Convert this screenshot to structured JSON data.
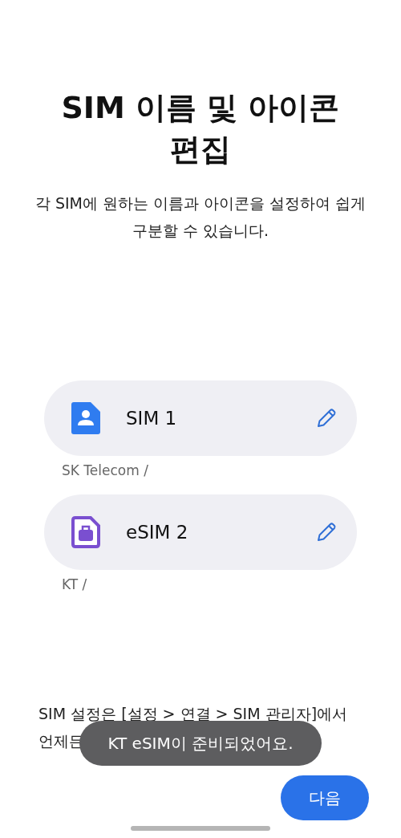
{
  "title": "SIM 이름 및 아이콘 편집",
  "subtitle": "각 SIM에 원하는 이름과 아이콘을 설정하여 쉽게 구분할 수 있습니다.",
  "sims": [
    {
      "name": "SIM 1",
      "carrier": "SK Telecom /",
      "kind": "person",
      "color": "#2f7cf0"
    },
    {
      "name": "eSIM 2",
      "carrier": "KT /",
      "kind": "briefcase",
      "color": "#7a4fd0"
    }
  ],
  "footer_lines": [
    "SIM 설정은 [설정 > 연결 > SIM 관리자]에서",
    "언제든"
  ],
  "toast": "KT eSIM이 준비되었어요.",
  "next_button": "다음"
}
